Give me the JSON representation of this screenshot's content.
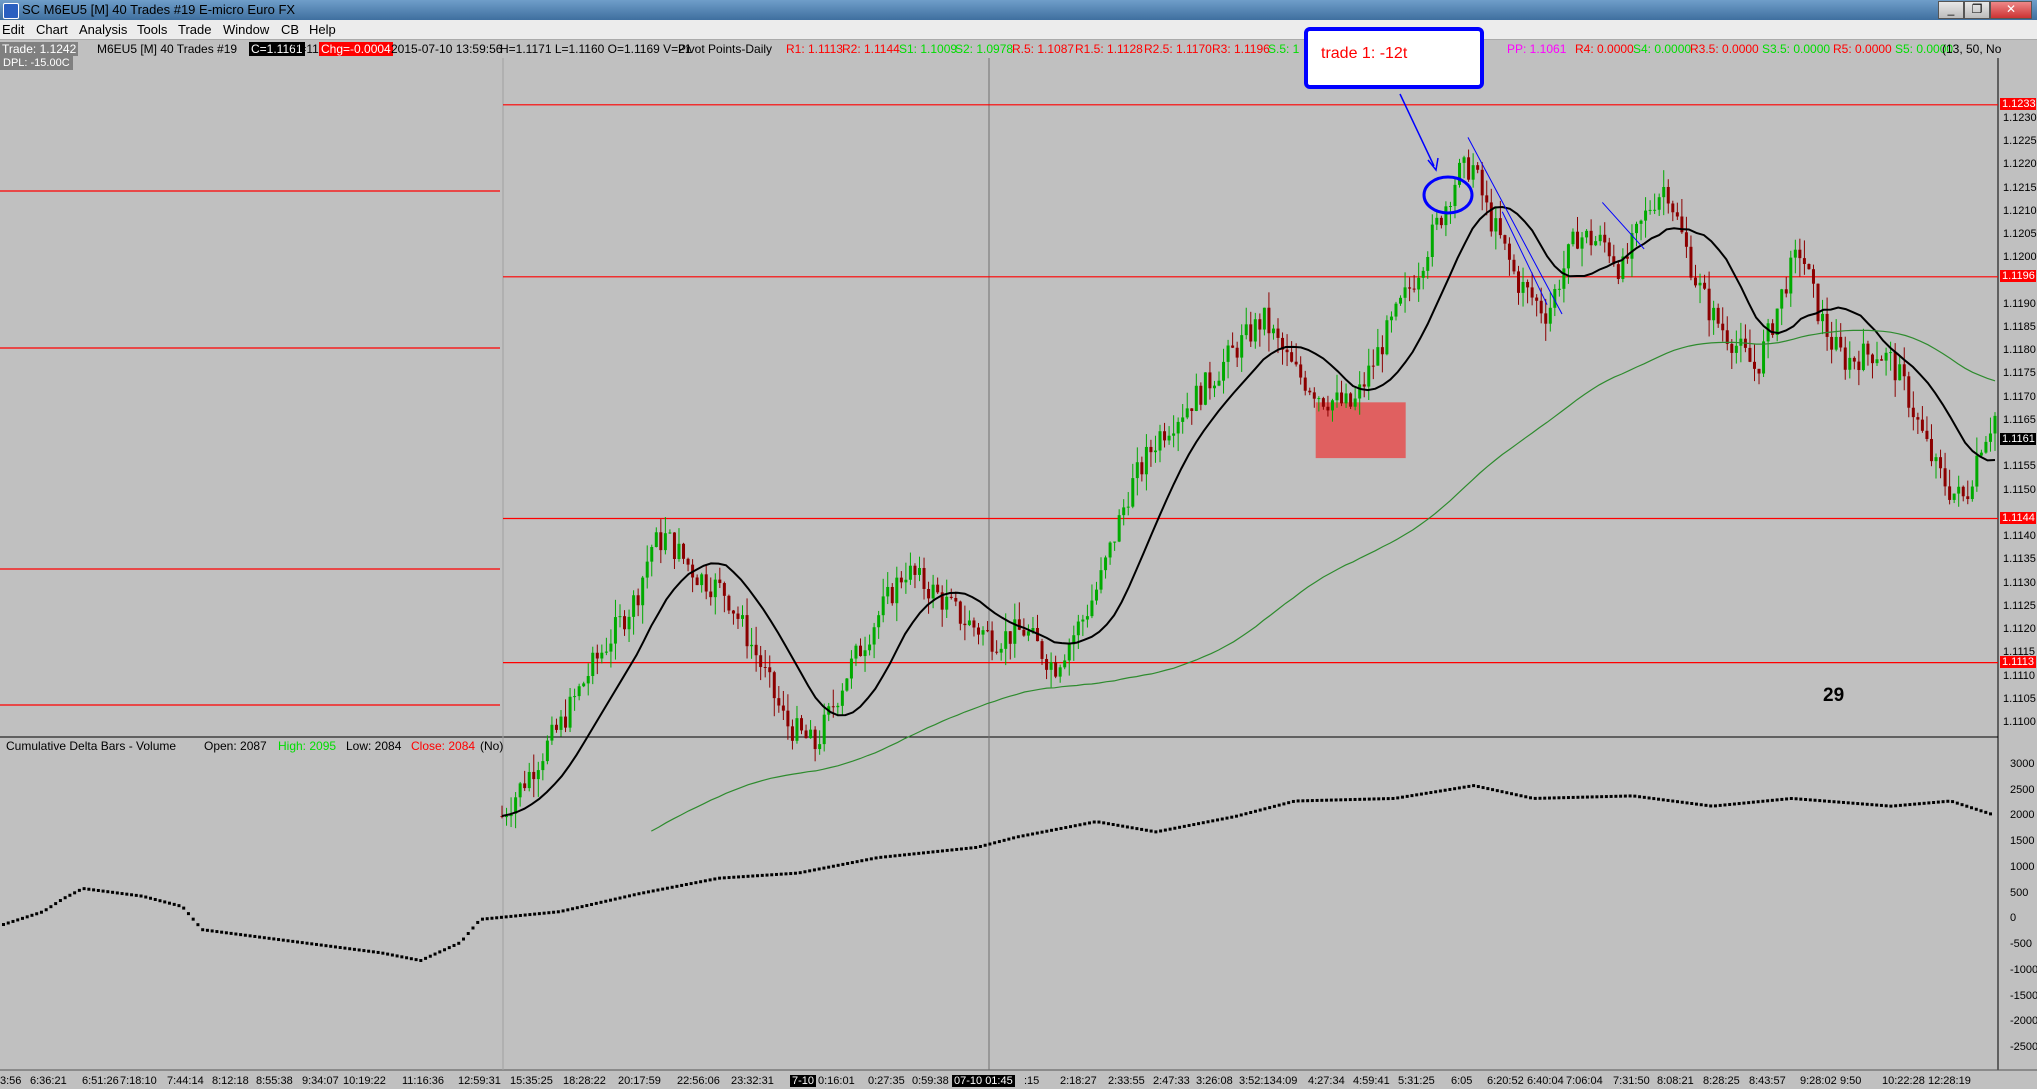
{
  "window": {
    "title": "SC M6EU5 [M]  40 Trades  #19  E-micro Euro FX",
    "minimize": "_",
    "restore": "❐",
    "close": "✕"
  },
  "menu": [
    "Edit",
    "Chart",
    "Analysis",
    "Tools",
    "Trade",
    "Window",
    "CB",
    "Help"
  ],
  "info": {
    "trade": "Trade: 1.1242",
    "symbol": "M6EU5 [M]  40 Trades  #19",
    "close": "C=1.1161",
    "ticks": "T=11",
    "change": "Chg=-0.0004",
    "datetime": "2015-07-10 13:59:56",
    "hlov": "H=1.1171  L=1.1160  O=1.1169  V=21",
    "study": "Pivot Points-Daily",
    "r1": "R1: 1.1113",
    "r2": "R2: 1.1144",
    "s1": "S1: 1.1009",
    "s2": "S2: 1.0978",
    "r_5": "R.5: 1.1087",
    "r1_5": "R1.5: 1.1128",
    "r2_5": "R2.5: 1.1170",
    "r3": "R3: 1.1196",
    "s_5": "S.5: 1",
    "pp": "PP: 1.1061",
    "r4": "R4: 0.0000",
    "s4": "S4: 0.0000",
    "r3_5": "R3.5: 0.0000",
    "s3_5": "S3.5: 0.0000",
    "r5": "R5: 0.0000",
    "s5": "S5: 0.0000",
    "settings": "(13, 50, No",
    "dpl": "DPL: -15.00C"
  },
  "annotations": {
    "callout": "trade 1: -12t",
    "counter": "29"
  },
  "price_axis": {
    "labels": [
      "1.1230",
      "1.1225",
      "1.1220",
      "1.1215",
      "1.1210",
      "1.1205",
      "1.1200",
      "1.1190",
      "1.1185",
      "1.1180",
      "1.1175",
      "1.1170",
      "1.1165",
      "1.1155",
      "1.1150",
      "1.1140",
      "1.1135",
      "1.1130",
      "1.1125",
      "1.1120",
      "1.1115",
      "1.1110",
      "1.1105",
      "1.1100"
    ],
    "badges": [
      {
        "text": "1.1233",
        "color": "#ff0000"
      },
      {
        "text": "1.1196",
        "color": "#ff0000"
      },
      {
        "text": "1.1161",
        "color": "#000000"
      },
      {
        "text": "1.1144",
        "color": "#ff0000"
      },
      {
        "text": "1.1113",
        "color": "#ff0000"
      }
    ]
  },
  "delta": {
    "title": "Cumulative Delta Bars - Volume",
    "open": "Open: 2087",
    "high": "High: 2095",
    "low": "Low: 2084",
    "close": "Close: 2084",
    "no": "(No)",
    "axis": [
      "3000",
      "2500",
      "2000",
      "1500",
      "1000",
      "500",
      "0",
      "-500",
      "-1000",
      "-1500",
      "-2000",
      "-2500"
    ]
  },
  "time_axis": [
    "3:56",
    "6:36:21",
    "6:51:26",
    "7:18:10",
    "7:44:14",
    "8:12:18",
    "8:55:38",
    "9:34:07",
    "10:19:22",
    "11:16:36",
    "12:59:31",
    "15:35:25",
    "18:28:22",
    "20:17:59",
    "22:56:06",
    "23:32:31",
    "7-10",
    "0:16:01",
    "0:27:35",
    "0:59:38",
    "07-10  01:45",
    ":15",
    "2:18:27",
    "2:33:55",
    "2:47:33",
    "3:26:08",
    "3:52:13",
    "4:09",
    "4:27:34",
    "4:59:41",
    "5:31:25",
    "6:05",
    "6:20:52",
    "6:40:04",
    "7:06:04",
    "7:31:50",
    "8:08:21",
    "8:28:25",
    "8:43:57",
    "9:28:02",
    "9:50",
    "10:22:28",
    "12:28:19"
  ],
  "colors": {
    "background": "#c0c0c0",
    "pivot_line": "#ff0000",
    "up_bar": "#00aa00",
    "down_bar": "#8b0000",
    "ma_fast": "#000000",
    "ma_slow": "#2e8b2e",
    "trendline": "#0000ff",
    "zone": "#e06060"
  },
  "chart_data": {
    "type": "candlestick",
    "ylim": [
      1.1097,
      1.1242
    ],
    "pivot_levels": [
      1.1233,
      1.1196,
      1.1144,
      1.1113
    ],
    "last_price": 1.1161,
    "price_path": [
      [
        0.0,
        1.108
      ],
      [
        0.04,
        1.11
      ],
      [
        0.06,
        1.1112
      ],
      [
        0.09,
        1.1127
      ],
      [
        0.1,
        1.1138
      ],
      [
        0.11,
        1.114
      ],
      [
        0.13,
        1.1132
      ],
      [
        0.15,
        1.1128
      ],
      [
        0.17,
        1.1115
      ],
      [
        0.19,
        1.11
      ],
      [
        0.21,
        1.1095
      ],
      [
        0.23,
        1.111
      ],
      [
        0.25,
        1.1122
      ],
      [
        0.27,
        1.1133
      ],
      [
        0.29,
        1.1128
      ],
      [
        0.31,
        1.1122
      ],
      [
        0.33,
        1.1118
      ],
      [
        0.35,
        1.112
      ],
      [
        0.37,
        1.1112
      ],
      [
        0.39,
        1.1123
      ],
      [
        0.4,
        1.113
      ],
      [
        0.42,
        1.115
      ],
      [
        0.44,
        1.1162
      ],
      [
        0.47,
        1.1172
      ],
      [
        0.49,
        1.118
      ],
      [
        0.51,
        1.1187
      ],
      [
        0.53,
        1.1176
      ],
      [
        0.55,
        1.117
      ],
      [
        0.57,
        1.1168
      ],
      [
        0.59,
        1.1182
      ],
      [
        0.61,
        1.1195
      ],
      [
        0.63,
        1.121
      ],
      [
        0.64,
        1.1218
      ],
      [
        0.65,
        1.122
      ],
      [
        0.66,
        1.121
      ],
      [
        0.67,
        1.1203
      ],
      [
        0.68,
        1.1195
      ],
      [
        0.7,
        1.1188
      ],
      [
        0.71,
        1.1197
      ],
      [
        0.72,
        1.1205
      ],
      [
        0.74,
        1.1203
      ],
      [
        0.75,
        1.1197
      ],
      [
        0.76,
        1.1205
      ],
      [
        0.77,
        1.1212
      ],
      [
        0.78,
        1.1216
      ],
      [
        0.79,
        1.1205
      ],
      [
        0.8,
        1.1195
      ],
      [
        0.81,
        1.1188
      ],
      [
        0.83,
        1.118
      ],
      [
        0.84,
        1.1176
      ],
      [
        0.85,
        1.1185
      ],
      [
        0.86,
        1.1195
      ],
      [
        0.87,
        1.1202
      ],
      [
        0.88,
        1.119
      ],
      [
        0.89,
        1.1182
      ],
      [
        0.9,
        1.1178
      ],
      [
        0.92,
        1.118
      ],
      [
        0.93,
        1.1178
      ],
      [
        0.94,
        1.1172
      ],
      [
        0.95,
        1.1163
      ],
      [
        0.96,
        1.1155
      ],
      [
        0.97,
        1.115
      ],
      [
        0.98,
        1.1148
      ],
      [
        0.99,
        1.116
      ],
      [
        1.0,
        1.1166
      ]
    ],
    "delta_path": [
      [
        0.0,
        -100
      ],
      [
        0.02,
        150
      ],
      [
        0.03,
        400
      ],
      [
        0.04,
        600
      ],
      [
        0.05,
        550
      ],
      [
        0.07,
        450
      ],
      [
        0.09,
        250
      ],
      [
        0.1,
        -200
      ],
      [
        0.13,
        -350
      ],
      [
        0.16,
        -500
      ],
      [
        0.19,
        -650
      ],
      [
        0.21,
        -800
      ],
      [
        0.23,
        -450
      ],
      [
        0.24,
        0
      ],
      [
        0.28,
        150
      ],
      [
        0.32,
        500
      ],
      [
        0.36,
        800
      ],
      [
        0.4,
        900
      ],
      [
        0.44,
        1200
      ],
      [
        0.49,
        1400
      ],
      [
        0.51,
        1600
      ],
      [
        0.55,
        1900
      ],
      [
        0.58,
        1700
      ],
      [
        0.62,
        2000
      ],
      [
        0.65,
        2300
      ],
      [
        0.7,
        2350
      ],
      [
        0.74,
        2600
      ],
      [
        0.77,
        2350
      ],
      [
        0.82,
        2400
      ],
      [
        0.86,
        2200
      ],
      [
        0.9,
        2350
      ],
      [
        0.95,
        2200
      ],
      [
        0.98,
        2300
      ],
      [
        1.0,
        2050
      ]
    ]
  }
}
